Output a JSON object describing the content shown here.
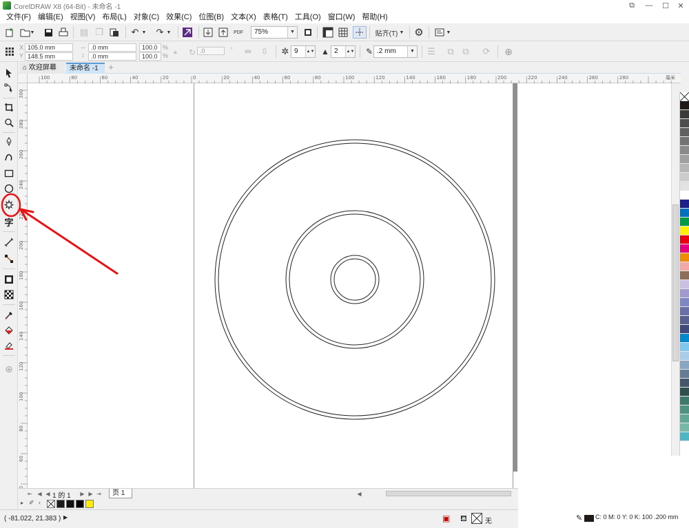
{
  "window": {
    "title": "CorelDRAW X8 (64-Bit) - 未命名 -1",
    "controls": [
      "restore-icon",
      "minimize-icon",
      "maximize-icon",
      "close-icon"
    ]
  },
  "menu": [
    {
      "label": "文件(F)"
    },
    {
      "label": "编辑(E)"
    },
    {
      "label": "视图(V)"
    },
    {
      "label": "布局(L)"
    },
    {
      "label": "对象(C)"
    },
    {
      "label": "效果(C)"
    },
    {
      "label": "位图(B)"
    },
    {
      "label": "文本(X)"
    },
    {
      "label": "表格(T)"
    },
    {
      "label": "工具(O)"
    },
    {
      "label": "窗口(W)"
    },
    {
      "label": "帮助(H)"
    }
  ],
  "standard_toolbar": {
    "zoom": "75%",
    "snap_label": "贴齐(T)",
    "pdf_label": "PDF"
  },
  "property_bar": {
    "x": "105.0 mm",
    "y": "148.5 mm",
    "width": ".0 mm",
    "height": ".0 mm",
    "scale_x": "100.0",
    "scale_y": "100.0",
    "percent_sign": "%",
    "rotation": ".0",
    "points": "9",
    "sharpness": "2",
    "outline_width": ".2 mm"
  },
  "doc_tabs": [
    {
      "label": "欢迎屏幕",
      "active": false
    },
    {
      "label": "未命名 -1",
      "active": true
    }
  ],
  "ruler": {
    "h_labels": [
      "100",
      "80",
      "60",
      "40",
      "20",
      "0",
      "20",
      "40",
      "60",
      "80",
      "100",
      "120",
      "140",
      "160",
      "180",
      "200",
      "220",
      "240",
      "260",
      "280"
    ],
    "h_unit": "毫米",
    "v_labels": [
      "300",
      "280",
      "260",
      "240",
      "220",
      "200",
      "180",
      "160",
      "140",
      "120",
      "100",
      "80",
      "60",
      "40"
    ]
  },
  "page_nav": {
    "current": "1",
    "of": "的",
    "total": "1",
    "page_tab": "页 1"
  },
  "doc_palette": {
    "colors": [
      "#1f1a17",
      "#111111",
      "#000000",
      "#ffee00"
    ]
  },
  "palette": {
    "colors": [
      "#1f1a17",
      "#3a3a3a",
      "#4d4d4d",
      "#606060",
      "#737373",
      "#8a8a8a",
      "#a0a0a0",
      "#b6b6b6",
      "#cccccc",
      "#e2e2e2",
      "#ffffff",
      "#1d2088",
      "#0070c0",
      "#009944",
      "#fff100",
      "#e60012",
      "#e4007f",
      "#ee8b00",
      "#f4a7a7",
      "#8c6e5a",
      "#c9c0e2",
      "#a19ad1",
      "#7f87c2",
      "#6b6fa8",
      "#58608f",
      "#3e4a7a",
      "#0088cc",
      "#7ec8ef",
      "#a9cdea",
      "#88a6bf",
      "#647d94",
      "#44566a",
      "#2f4f4f",
      "#3d7a6b",
      "#4e9282",
      "#62a896",
      "#76b9a8",
      "#4db6c2"
    ]
  },
  "status": {
    "coords": "( -81.022, 21.383 )",
    "fill_label": "无",
    "stroke_info": "C: 0 M: 0 Y: 0 K: 100  .200 mm"
  },
  "drawing": {
    "circles": [
      {
        "radius": 203
      },
      {
        "radius": 198
      },
      {
        "radius": 100
      },
      {
        "radius": 95
      },
      {
        "radius": 35
      },
      {
        "radius": 30
      }
    ]
  }
}
